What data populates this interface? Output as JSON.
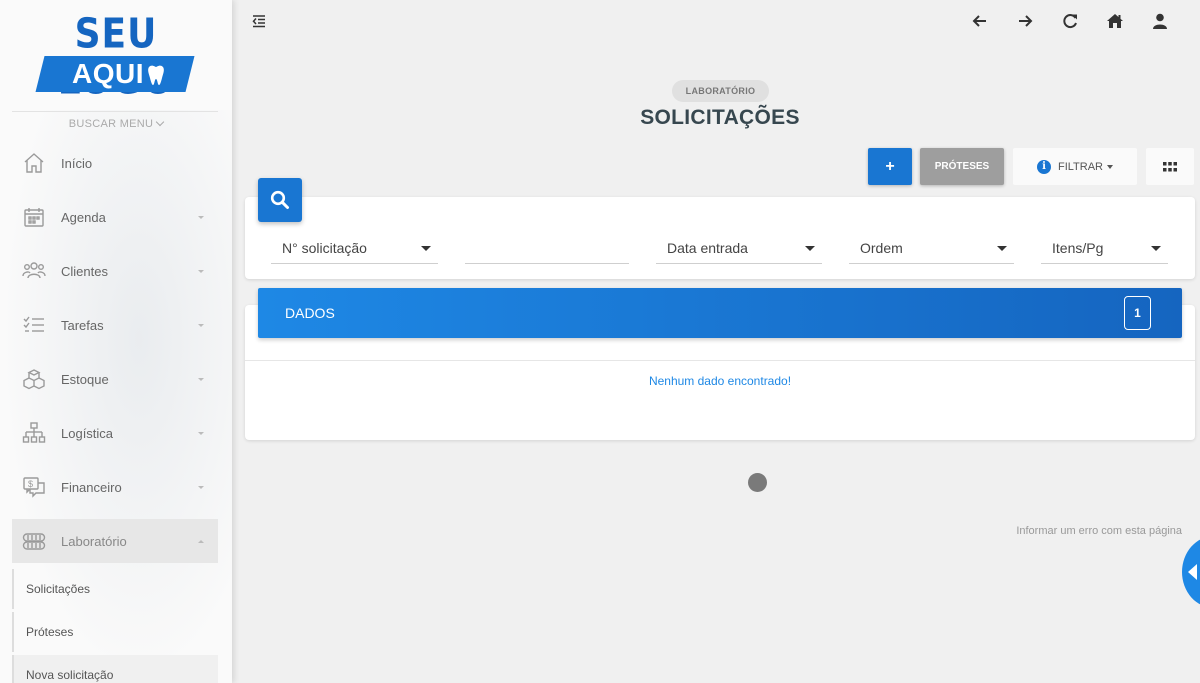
{
  "logo": {
    "line1": "SEU LOGO",
    "line2": "AQUI"
  },
  "sidebar": {
    "search_menu": "BUSCAR MENU",
    "items": [
      {
        "label": "Início",
        "icon": "home-icon"
      },
      {
        "label": "Agenda",
        "icon": "calendar-icon"
      },
      {
        "label": "Clientes",
        "icon": "users-icon"
      },
      {
        "label": "Tarefas",
        "icon": "tasks-icon"
      },
      {
        "label": "Estoque",
        "icon": "boxes-icon"
      },
      {
        "label": "Logística",
        "icon": "org-chart-icon"
      },
      {
        "label": "Financeiro",
        "icon": "money-chat-icon"
      },
      {
        "label": "Laboratório",
        "icon": "dental-arch-icon"
      }
    ],
    "sub_items": [
      {
        "label": "Solicitações"
      },
      {
        "label": "Próteses"
      },
      {
        "label": "Nova solicitação"
      }
    ]
  },
  "header": {
    "breadcrumb": "LABORATÓRIO",
    "title": "SOLICITAÇÕES"
  },
  "actions": {
    "add_label": "+",
    "proteses_label": "PRÓTESES",
    "filter_label": "FILTRAR",
    "info_glyph": "i"
  },
  "filters": {
    "field1": "N° solicitação",
    "search_value": "",
    "field2": "Data entrada",
    "field3": "Ordem",
    "field4": "Itens/Pg"
  },
  "data_panel": {
    "title": "DADOS",
    "count": "1",
    "empty_message": "Nenhum dado encontrado!"
  },
  "footer": {
    "report_link": "Informar um erro com esta página"
  },
  "colors": {
    "primary": "#1976d2",
    "grey_button": "#9e9e9e",
    "title": "#37474f"
  }
}
